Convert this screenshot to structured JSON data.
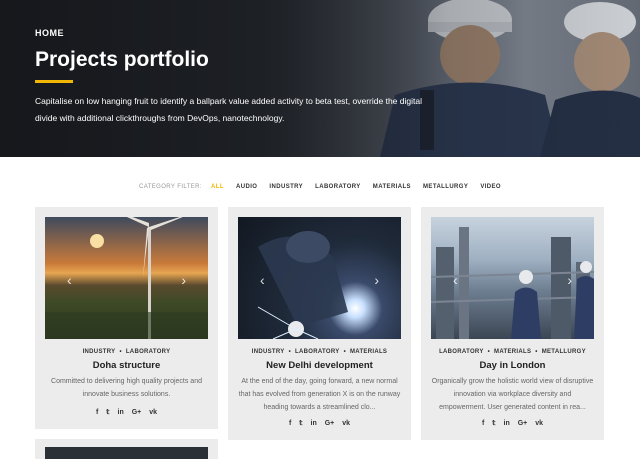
{
  "hero": {
    "breadcrumb": "HOME",
    "title": "Projects portfolio",
    "text": "Capitalise on low hanging fruit to identify a ballpark value added activity to beta test, override the digital divide with additional clickthroughs from DevOps, nanotechnology.",
    "accent_color": "#f2b705"
  },
  "filters": {
    "label": "CATEGORY FILTER:",
    "items": [
      "ALL",
      "AUDIO",
      "INDUSTRY",
      "LABORATORY",
      "MATERIALS",
      "METALLURGY",
      "VIDEO"
    ],
    "active": "ALL"
  },
  "cards": [
    {
      "categories": [
        "INDUSTRY",
        "LABORATORY"
      ],
      "title": "Doha structure",
      "description": "Committed to delivering high quality projects and innovate business solutions.",
      "image": "wind-turbine-sunset"
    },
    {
      "categories": [
        "INDUSTRY",
        "LABORATORY",
        "MATERIALS"
      ],
      "title": "New Delhi development",
      "description": "At the end of the day, going forward, a new normal that has evolved from generation X is on the runway heading towards a streamlined clo...",
      "image": "welder-sparks"
    },
    {
      "categories": [
        "LABORATORY",
        "MATERIALS",
        "METALLURGY"
      ],
      "title": "Day in London",
      "description": "Organically grow the holistic world view of disruptive innovation via workplace diversity and empowerment. User generated content in rea...",
      "image": "refinery-workers"
    }
  ],
  "social_icons": [
    "facebook-icon",
    "twitter-icon",
    "linkedin-icon",
    "google-plus-icon",
    "vk-icon"
  ],
  "social_glyphs": [
    "f",
    "𝕥",
    "in",
    "G+",
    "vk"
  ],
  "separator": "•",
  "arrows": {
    "prev": "‹",
    "next": "›"
  }
}
